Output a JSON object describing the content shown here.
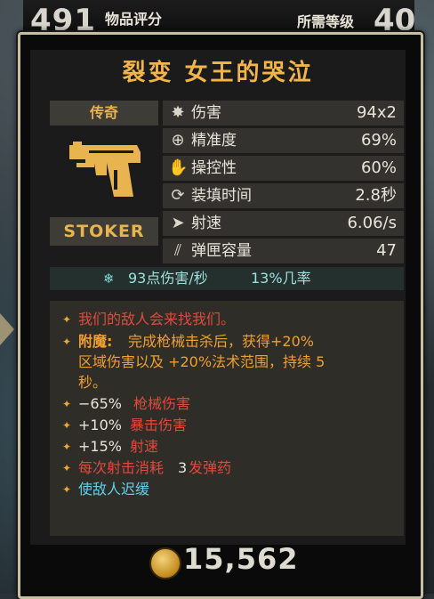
{
  "header": {
    "score": "491",
    "score_label": "物品评分",
    "level_label": "所需等级",
    "level": "40"
  },
  "item": {
    "name": "裂变 女王的哭泣",
    "rarity": "传奇",
    "brand": "STOKER",
    "accent_color": "#f2b54a"
  },
  "stats": [
    {
      "icon": "damage-icon",
      "label": "伤害",
      "value": "94x2"
    },
    {
      "icon": "accuracy-icon",
      "label": "精准度",
      "value": "69%"
    },
    {
      "icon": "handling-icon",
      "label": "操控性",
      "value": "60%"
    },
    {
      "icon": "reload-icon",
      "label": "装填时间",
      "value": "2.8秒"
    },
    {
      "icon": "fire-rate-icon",
      "label": "射速",
      "value": "6.06/s"
    },
    {
      "icon": "magazine-icon",
      "label": "弹匣容量",
      "value": "47"
    }
  ],
  "elemental": {
    "icon": "cryo-icon",
    "dps": "93点伤害/秒",
    "chance": "13%几率"
  },
  "description": {
    "flavor": "我们的敌人会来找我们。",
    "enchant_label": "附魔:",
    "enchant_line1": "完成枪械击杀后，获得+20%",
    "enchant_line2": "区域伤害以及 +20%法术范围，持续 5",
    "enchant_line3": "秒。",
    "mod1_value": "−65%",
    "mod1_text": "枪械伤害",
    "mod2_value": "+10%",
    "mod2_text": "暴击伤害",
    "mod3_value": "+15%",
    "mod3_text": "射速",
    "mod4_prefix": "每次射击消耗",
    "mod4_value": "3",
    "mod4_suffix": "发弹药",
    "mod5_text": "使敌人迟缓"
  },
  "price": "15,562"
}
